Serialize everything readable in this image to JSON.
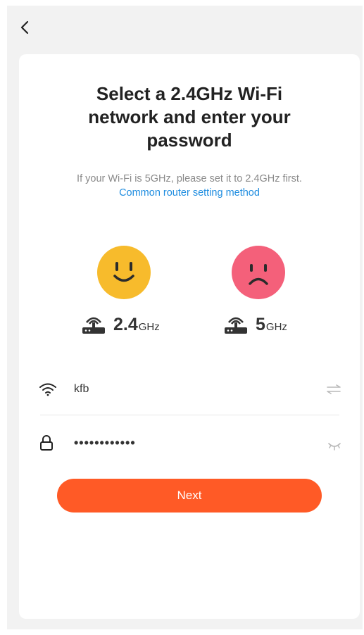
{
  "nav": {
    "back_icon": "chevron-left-icon"
  },
  "card": {
    "title": "Select a 2.4GHz Wi-Fi network and enter your password",
    "hint": "If your Wi-Fi is 5GHz, please set it to 2.4GHz first.",
    "link": "Common router setting method"
  },
  "bands": [
    {
      "face": "smiley-face-icon",
      "color": "#f7bb2c",
      "router_icon": "router-icon",
      "value": "2.4",
      "unit": "GHz"
    },
    {
      "face": "sad-face-icon",
      "color": "#f4607a",
      "router_icon": "router-icon",
      "value": "5",
      "unit": "GHz"
    }
  ],
  "form": {
    "ssid": {
      "icon": "wifi-icon",
      "value": "kfb",
      "action_icon": "switch-network-icon"
    },
    "password": {
      "icon": "lock-icon",
      "value": "••••••••••••",
      "action_icon": "eye-closed-icon"
    }
  },
  "next_label": "Next",
  "colors": {
    "accent": "#ff5a26",
    "link": "#1f8de0",
    "background": "#f2f2f2"
  }
}
